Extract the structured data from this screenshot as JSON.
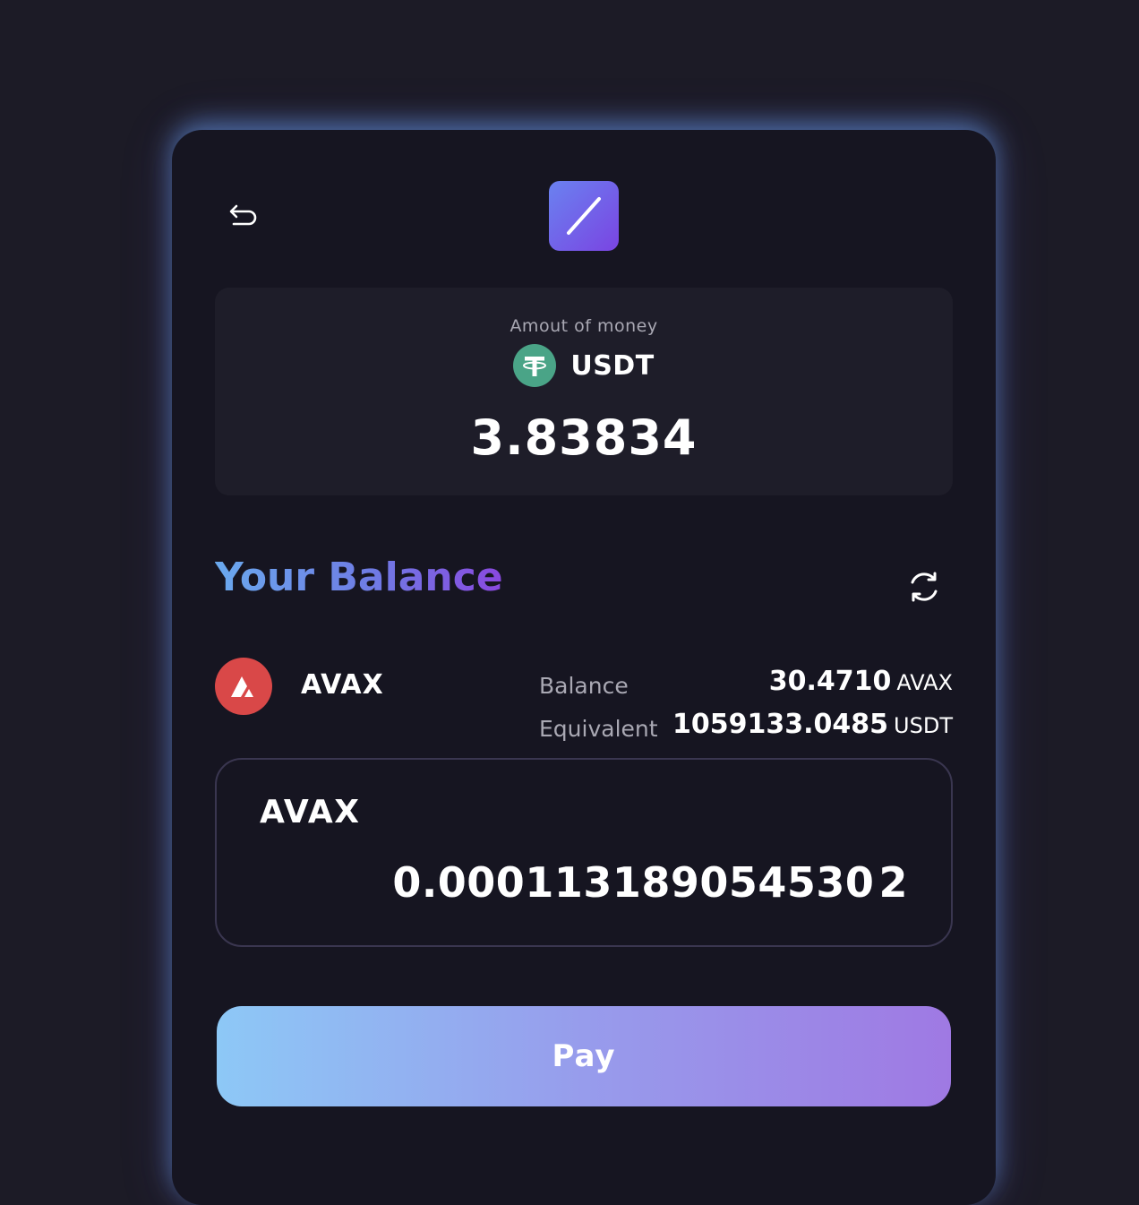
{
  "header": {
    "back_icon": "undo-arrow-icon",
    "logo_icon": "slash-logo-icon"
  },
  "amount": {
    "label": "Amout of money",
    "currency_icon": "tether-icon",
    "currency": "USDT",
    "value": "3.83834"
  },
  "balance": {
    "title": "Your Balance",
    "refresh_icon": "refresh-icon",
    "token_icon": "avalanche-icon",
    "token": "AVAX",
    "balance_label": "Balance",
    "balance_value": "30.4710",
    "balance_unit": "AVAX",
    "equivalent_label": "Equivalent",
    "equivalent_value": "1059133.0485",
    "equivalent_unit": "USDT"
  },
  "pay_input": {
    "token": "AVAX",
    "amount": "0.000113189054530 2"
  },
  "pay_button": {
    "label": "Pay"
  },
  "colors": {
    "background": "#1c1b26",
    "card": "#161521",
    "panel": "#1e1d29",
    "tether": "#4aa487",
    "avalanche": "#d94848",
    "gradient_start": "#8dc8f6",
    "gradient_end": "#9f79e3"
  }
}
